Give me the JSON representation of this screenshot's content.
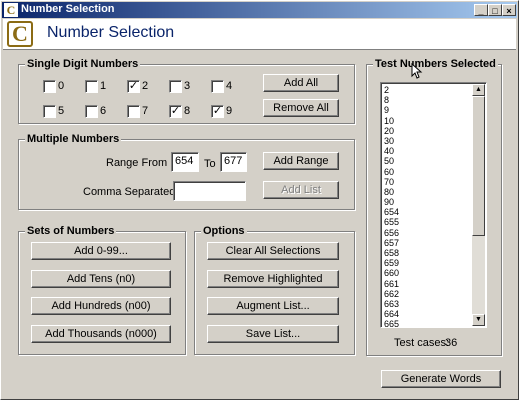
{
  "window": {
    "title": "Number Selection",
    "app_title": "Number Selection",
    "logo_letter": "C",
    "min_label": "_",
    "max_label": "□",
    "close_label": "×"
  },
  "single_digit": {
    "label": "Single Digit Numbers",
    "items": [
      {
        "label": "0",
        "checked": false
      },
      {
        "label": "1",
        "checked": false
      },
      {
        "label": "2",
        "checked": true
      },
      {
        "label": "3",
        "checked": false
      },
      {
        "label": "4",
        "checked": false
      },
      {
        "label": "5",
        "checked": false
      },
      {
        "label": "6",
        "checked": false
      },
      {
        "label": "7",
        "checked": false
      },
      {
        "label": "8",
        "checked": true
      },
      {
        "label": "9",
        "checked": true
      }
    ],
    "add_all": "Add All",
    "remove_all": "Remove All"
  },
  "multiple": {
    "label": "Multiple Numbers",
    "range_from_label": "Range From",
    "range_from_value": "654",
    "to_label": "To",
    "range_to_value": "677",
    "add_range": "Add Range",
    "comma_label": "Comma Separated List",
    "comma_value": "",
    "add_list": "Add List"
  },
  "sets": {
    "label": "Sets of Numbers",
    "add_0_99": "Add 0-99...",
    "add_tens": "Add Tens (n0)",
    "add_hundreds": "Add Hundreds (n00)",
    "add_thousands": "Add Thousands (n000)"
  },
  "options": {
    "label": "Options",
    "clear": "Clear All Selections",
    "remove": "Remove Highlighted",
    "augment": "Augment List...",
    "save": "Save List..."
  },
  "test_numbers": {
    "label": "Test Numbers Selected",
    "items": [
      "2",
      "8",
      "9",
      "10",
      "20",
      "30",
      "40",
      "50",
      "60",
      "70",
      "80",
      "90",
      "654",
      "655",
      "656",
      "657",
      "658",
      "659",
      "660",
      "661",
      "662",
      "663",
      "664",
      "665"
    ],
    "count_label": "Test cases:",
    "count_value": "36",
    "up_arrow": "▲",
    "down_arrow": "▼"
  },
  "generate": "Generate Words"
}
